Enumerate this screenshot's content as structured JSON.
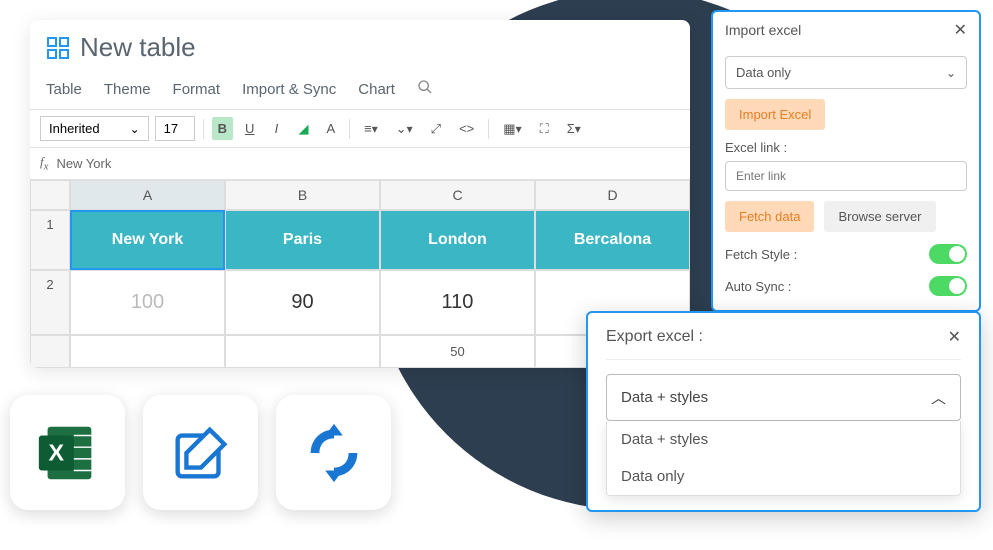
{
  "header": {
    "title": "New table"
  },
  "menu": {
    "table": "Table",
    "theme": "Theme",
    "format": "Format",
    "import": "Import & Sync",
    "chart": "Chart"
  },
  "toolbar": {
    "font": "Inherited",
    "size": "17"
  },
  "formula": {
    "value": "New York"
  },
  "columns": {
    "a": "A",
    "b": "B",
    "c": "C",
    "d": "D"
  },
  "rows": {
    "r1": "1",
    "r2": "2"
  },
  "cells": {
    "a1": "New York",
    "b1": "Paris",
    "c1": "London",
    "d1": "Bercalona",
    "a2": "100",
    "b2": "90",
    "c2": "110",
    "c3": "50"
  },
  "import_panel": {
    "title": "Import excel",
    "mode": "Data only",
    "import_btn": "Import Excel",
    "link_label": "Excel link :",
    "link_placeholder": "Enter link",
    "fetch_btn": "Fetch data",
    "browse_btn": "Browse server",
    "fetch_style": "Fetch Style :",
    "auto_sync": "Auto Sync :"
  },
  "export_panel": {
    "title": "Export excel :",
    "selected": "Data + styles",
    "opt1": "Data + styles",
    "opt2": "Data only"
  }
}
